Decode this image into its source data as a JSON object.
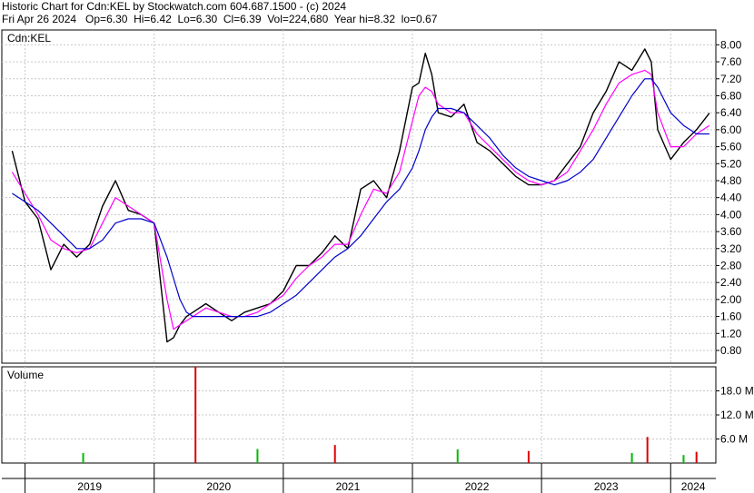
{
  "header": {
    "line1": "Historic Chart for Cdn:KEL by Stockwatch.com 604.687.1500 - (c) 2024",
    "line2": "Fri Apr 26 2024   Op=6.30  Hi=6.42  Lo=6.30  Cl=6.39  Vol=224,680  Year hi=8.32  lo=0.67"
  },
  "chart_data": [
    {
      "type": "line",
      "title": "Cdn:KEL",
      "ylim": [
        0.5,
        8.35
      ],
      "y_ticks": [
        "0.80",
        "1.20",
        "1.60",
        "2.00",
        "2.40",
        "2.80",
        "3.20",
        "3.60",
        "4.00",
        "4.40",
        "4.80",
        "5.20",
        "5.60",
        "6.00",
        "6.40",
        "6.80",
        "7.20",
        "7.60",
        "8.00"
      ],
      "x_ticks": [
        "2019",
        "2020",
        "2021",
        "2022",
        "2023",
        "2024"
      ],
      "grid": true,
      "colors": {
        "price": "#000000",
        "ma_short": "#ff00ff",
        "ma_long": "#0000cc"
      },
      "x": [
        2018.9,
        2019.0,
        2019.1,
        2019.2,
        2019.3,
        2019.4,
        2019.5,
        2019.6,
        2019.7,
        2019.8,
        2019.9,
        2020.0,
        2020.1,
        2020.15,
        2020.2,
        2020.25,
        2020.3,
        2020.4,
        2020.5,
        2020.6,
        2020.7,
        2020.8,
        2020.9,
        2021.0,
        2021.1,
        2021.2,
        2021.3,
        2021.4,
        2021.5,
        2021.6,
        2021.7,
        2021.8,
        2021.9,
        2022.0,
        2022.05,
        2022.1,
        2022.15,
        2022.2,
        2022.3,
        2022.4,
        2022.5,
        2022.6,
        2022.7,
        2022.8,
        2022.9,
        2023.0,
        2023.1,
        2023.2,
        2023.3,
        2023.4,
        2023.5,
        2023.6,
        2023.7,
        2023.8,
        2023.85,
        2023.9,
        2024.0,
        2024.1,
        2024.2,
        2024.3
      ],
      "series": [
        {
          "values": [
            5.5,
            4.3,
            3.9,
            2.7,
            3.3,
            3.0,
            3.3,
            4.2,
            4.8,
            4.1,
            4.0,
            3.8,
            1.0,
            1.1,
            1.4,
            1.6,
            1.7,
            1.9,
            1.7,
            1.5,
            1.7,
            1.8,
            1.9,
            2.2,
            2.8,
            2.8,
            3.1,
            3.5,
            3.2,
            4.6,
            4.8,
            4.4,
            5.5,
            7.0,
            7.1,
            7.8,
            7.3,
            6.4,
            6.3,
            6.6,
            5.7,
            5.5,
            5.2,
            4.9,
            4.7,
            4.7,
            4.8,
            5.2,
            5.6,
            6.4,
            6.9,
            7.6,
            7.4,
            7.9,
            7.6,
            6.0,
            5.3,
            5.7,
            6.0,
            6.39
          ]
        },
        {
          "values": [
            5.0,
            4.5,
            4.0,
            3.4,
            3.2,
            3.1,
            3.2,
            3.8,
            4.4,
            4.2,
            4.0,
            3.8,
            2.0,
            1.3,
            1.4,
            1.5,
            1.6,
            1.8,
            1.7,
            1.6,
            1.6,
            1.7,
            1.9,
            2.1,
            2.5,
            2.8,
            3.0,
            3.3,
            3.3,
            4.0,
            4.6,
            4.5,
            5.0,
            6.2,
            6.8,
            7.0,
            6.9,
            6.6,
            6.4,
            6.4,
            5.9,
            5.6,
            5.3,
            5.0,
            4.8,
            4.7,
            4.8,
            5.0,
            5.5,
            6.0,
            6.6,
            7.1,
            7.3,
            7.4,
            7.3,
            6.4,
            5.6,
            5.6,
            5.9,
            6.1
          ]
        },
        {
          "values": [
            4.5,
            4.3,
            4.1,
            3.8,
            3.5,
            3.2,
            3.2,
            3.4,
            3.8,
            3.9,
            3.9,
            3.8,
            3.0,
            2.5,
            2.0,
            1.7,
            1.6,
            1.6,
            1.6,
            1.6,
            1.6,
            1.6,
            1.7,
            1.9,
            2.1,
            2.4,
            2.7,
            3.0,
            3.2,
            3.5,
            3.9,
            4.3,
            4.6,
            5.1,
            5.5,
            6.0,
            6.3,
            6.5,
            6.5,
            6.4,
            6.1,
            5.8,
            5.4,
            5.1,
            4.9,
            4.8,
            4.7,
            4.8,
            5.0,
            5.3,
            5.8,
            6.3,
            6.8,
            7.2,
            7.2,
            7.0,
            6.4,
            6.1,
            5.9,
            5.9
          ]
        }
      ]
    },
    {
      "type": "bar",
      "title": "Volume",
      "ylim": [
        0,
        24
      ],
      "y_ticks": [
        "6.0 M",
        "12.0 M",
        "18.0 M"
      ],
      "x": [
        2019.45,
        2020.32,
        2020.8,
        2021.4,
        2022.35,
        2022.9,
        2023.7,
        2023.82,
        2024.1,
        2024.2
      ],
      "values": [
        2.5,
        24.0,
        3.5,
        4.5,
        3.4,
        3.0,
        2.5,
        6.5,
        2.0,
        2.8
      ],
      "colors": {
        "up": "#00bb00",
        "down": "#dd0000"
      }
    }
  ]
}
